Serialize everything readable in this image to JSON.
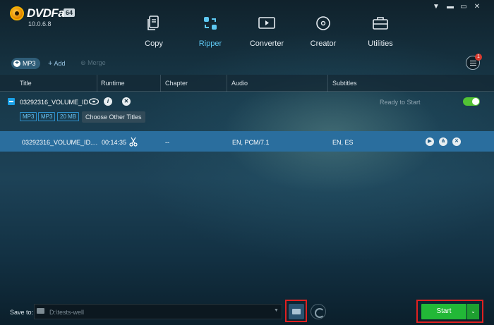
{
  "app": {
    "name": "DVDFab",
    "edition": "64",
    "version": "10.0.6.8"
  },
  "nav": {
    "items": [
      {
        "label": "Copy",
        "icon": "copy-icon"
      },
      {
        "label": "Ripper",
        "icon": "ripper-icon",
        "active": true
      },
      {
        "label": "Converter",
        "icon": "converter-icon"
      },
      {
        "label": "Creator",
        "icon": "creator-icon"
      },
      {
        "label": "Utilities",
        "icon": "utilities-icon"
      }
    ]
  },
  "toolbar": {
    "profile_label": "MP3",
    "add_label": "Add",
    "merge_label": "Merge",
    "task_badge": "1"
  },
  "table": {
    "columns": [
      "Title",
      "Runtime",
      "Chapter",
      "Audio",
      "Subtitles"
    ],
    "source": {
      "title": "03292316_VOLUME_ID",
      "status": "Ready to Start",
      "tags": [
        "MP3",
        "MP3",
        "20 MB"
      ],
      "choose_label": "Choose Other Titles"
    },
    "rows": [
      {
        "title": "03292316_VOLUME_ID....",
        "runtime": "00:14:35",
        "chapter": "--",
        "audio": "EN, PCM/7.1",
        "subtitles": "EN, ES"
      }
    ]
  },
  "footer": {
    "save_to_label": "Save to:",
    "save_path": "D:\\tests-well",
    "start_label": "Start"
  },
  "colors": {
    "accent": "#5ec8f2",
    "selected_row": "#2a6e9e",
    "start_button": "#22b837",
    "toggle_on": "#52c234",
    "highlight_box": "#e02020"
  }
}
